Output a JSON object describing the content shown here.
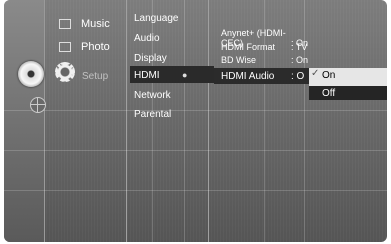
{
  "left_menu": [
    {
      "label": "Music",
      "icon": "music-icon"
    },
    {
      "label": "Photo",
      "icon": "photo-icon"
    },
    {
      "label": "Setup",
      "icon": "gear-icon"
    }
  ],
  "setup_menu": [
    "Language",
    "Audio",
    "Display",
    "HDMI",
    "Network",
    "Parental"
  ],
  "selected_menu": "HDMI",
  "hdmi_settings": [
    {
      "name": "Anynet+ (HDMI-CEC)",
      "value": ": On"
    },
    {
      "name": "HDMI Format",
      "value": ": TV"
    },
    {
      "name": "BD Wise",
      "value": ": On"
    },
    {
      "name": "HDMI Audio",
      "value": ": O"
    }
  ],
  "dropdown": {
    "options": [
      "On",
      "Off"
    ],
    "checked": "On",
    "highlighted": "Off"
  }
}
